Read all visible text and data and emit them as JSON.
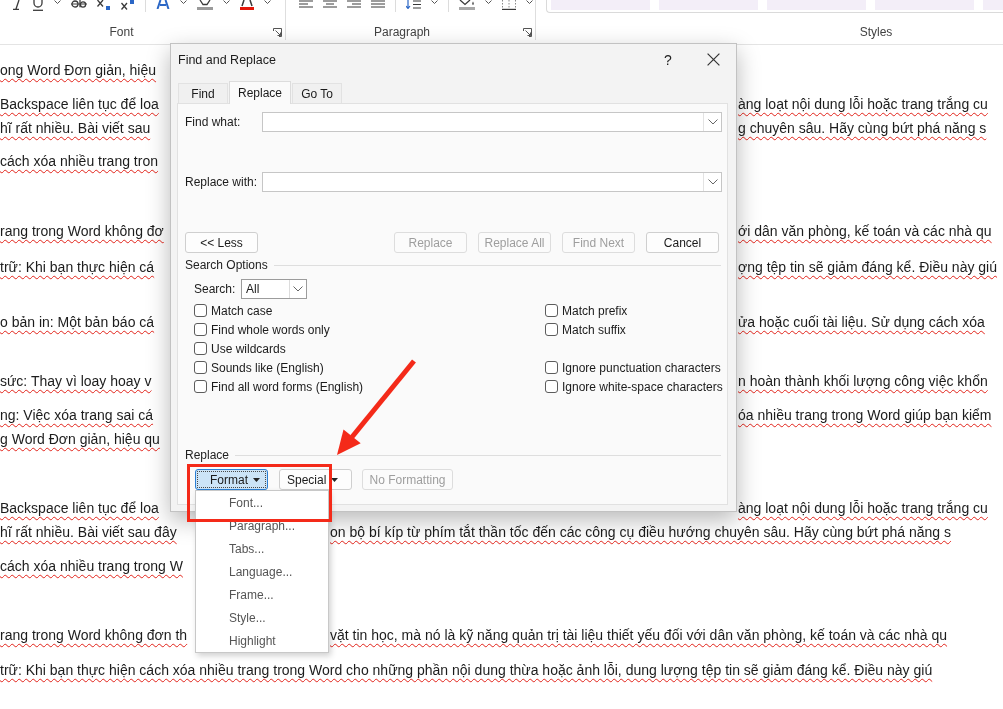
{
  "ribbon": {
    "groups": [
      {
        "kind": "font",
        "label": "Font",
        "launcher": true
      },
      {
        "kind": "paragraph",
        "label": "Paragraph",
        "launcher": true
      },
      {
        "kind": "styles",
        "label": "Styles",
        "launcher": false
      }
    ]
  },
  "document": {
    "paragraphs": [
      {
        "lines": [
          {
            "segments": [
              "ong Word Đơn giản, hiệu"
            ]
          }
        ]
      },
      {
        "lines": [
          {
            "segments": [
              "Backspace liên tục để loa",
              "àng loạt nội dung lỗi hoặc trang trắng cu"
            ]
          },
          {
            "segments": [
              "hĩ rất nhiều. Bài viết sau",
              "g chuyên sâu. Hãy cùng bứt phá năng s"
            ]
          }
        ]
      },
      {
        "lines": [
          {
            "segments": [
              "cách xóa nhiều trang tron"
            ]
          }
        ]
      },
      {
        "lines": [
          {
            "segments": [
              "rang trong Word không đơ",
              "ới dân văn phòng, kế toán và các nhà qu"
            ]
          }
        ]
      },
      {
        "lines": [
          {
            "segments": [
              "trữ: Khi bạn thực hiện cá",
              "ợng tệp tin sẽ giảm đáng kể. Điều này giú"
            ]
          }
        ]
      },
      {
        "lines": [
          {
            "segments": [
              "o bản in: Một bản báo cá",
              "ửa hoặc cuối tài liệu. Sử dụng cách xóa"
            ]
          }
        ]
      },
      {
        "lines": [
          {
            "segments": [
              "sức: Thay vì loay hoay v",
              "n hoàn thành khối lượng công việc khổn"
            ]
          }
        ]
      },
      {
        "lines": [
          {
            "segments": [
              "ng: Việc xóa trang sai cá",
              "óa nhiều trang trong Word giúp bạn kiểm"
            ]
          },
          {
            "segments": [
              "g Word Đơn giản, hiệu qu"
            ]
          }
        ]
      },
      {
        "lines": [
          {
            "segments": [
              "Backspace liên tục để loa",
              "àng loạt nội dung lỗi hoặc trang trắng cu"
            ]
          },
          {
            "segments": [
              "hĩ rất nhiều. Bài viết sau đây",
              "on bộ bí kíp từ phím tắt thần tốc đến các công cụ điều hướng chuyên sâu. Hãy cùng bứt phá năng s"
            ]
          }
        ]
      },
      {
        "lines": [
          {
            "segments": [
              "cách xóa nhiều trang trong W"
            ]
          }
        ]
      },
      {
        "lines": [
          {
            "segments": [
              "rang trong Word không đơn th",
              "vặt tin học, mà nó là kỹ năng quản trị tài liệu thiết yếu đối với dân văn phòng, kế toán và các nhà qu"
            ]
          }
        ]
      },
      {
        "lines": [
          {
            "segments": [
              "trữ: Khi bạn thực hiện cách xóa nhiều trang trong Word cho những phần nội dung thừa hoặc ảnh lỗi, dung lượng tệp tin sẽ giảm đáng kể. Điều này giú"
            ]
          }
        ]
      }
    ]
  },
  "dialog": {
    "title": "Find and Replace",
    "help_button": "?",
    "tabs": [
      {
        "label": "Find",
        "selected": false
      },
      {
        "label": "Replace",
        "selected": true
      },
      {
        "label": "Go To",
        "selected": false
      }
    ],
    "fields": [
      {
        "label": "Find what:"
      },
      {
        "label": "Replace with:"
      }
    ],
    "less_button": {
      "label": "<< Less"
    },
    "action_buttons": [
      {
        "label": "Replace",
        "disabled": true
      },
      {
        "label": "Replace All",
        "disabled": true
      },
      {
        "label": "Find Next",
        "disabled": true
      },
      {
        "label": "Cancel",
        "disabled": false
      }
    ],
    "search_options": {
      "title": "Search Options",
      "search_label": "Search:",
      "search_value": "All",
      "left_options": [
        {
          "label": "Match case",
          "checked": false
        },
        {
          "label": "Find whole words only",
          "checked": false
        },
        {
          "label": "Use wildcards",
          "checked": false
        },
        {
          "label": "Sounds like (English)",
          "checked": false
        },
        {
          "label": "Find all word forms (English)",
          "checked": false
        }
      ],
      "right_groups": [
        [
          {
            "label": "Match prefix",
            "checked": false
          },
          {
            "label": "Match suffix",
            "checked": false
          }
        ],
        [
          {
            "label": "Ignore punctuation characters",
            "checked": false
          },
          {
            "label": "Ignore white-space characters",
            "checked": false
          }
        ]
      ]
    },
    "replace_section": {
      "title": "Replace",
      "buttons": [
        {
          "label": "Format",
          "dropdown": true,
          "pressed": true,
          "disabled": false
        },
        {
          "label": "Special",
          "dropdown": true,
          "pressed": false,
          "disabled": false
        },
        {
          "label": "No Formatting",
          "dropdown": false,
          "pressed": false,
          "disabled": true
        }
      ]
    }
  },
  "format_menu": {
    "items": [
      {
        "label": "Font..."
      },
      {
        "label": "Paragraph..."
      },
      {
        "label": "Tabs..."
      },
      {
        "label": "Language..."
      },
      {
        "label": "Frame..."
      },
      {
        "label": "Style..."
      },
      {
        "label": "Highlight"
      }
    ]
  },
  "annotations": {
    "frame": true,
    "arrow": true
  }
}
